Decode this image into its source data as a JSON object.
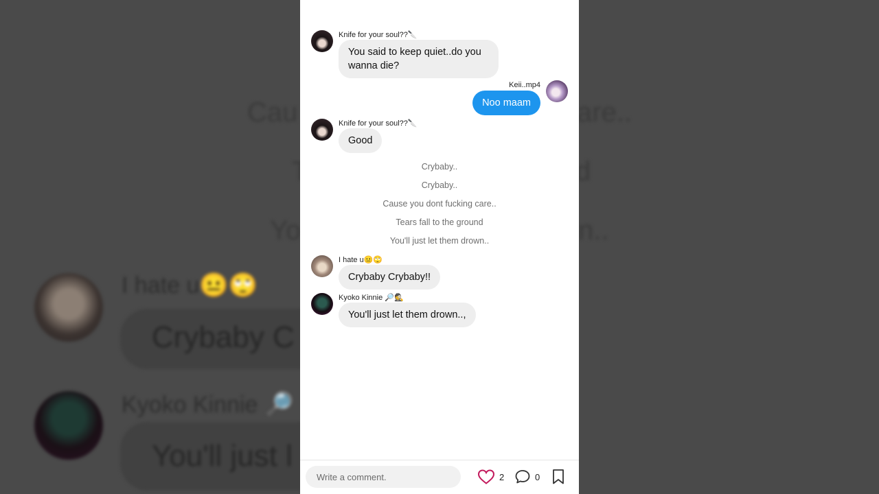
{
  "background": {
    "line1_left": "Cau",
    "line1_right": "are..",
    "line2_left": "T",
    "line2_right": "d",
    "line3_left": "Yo",
    "line3_right": "n..",
    "name1": "I hate u😐🙄",
    "msg1": "Crybaby C",
    "name2": "Kyoko Kinnie 🔎",
    "msg2": "You'll just l"
  },
  "messages": [
    {
      "sender": "Knife for your soul??🔪",
      "text_line1": "You said to keep quiet..do you",
      "text_line2": "wanna die?"
    },
    {
      "sender": "Keii..mp4",
      "text": "Noo maam"
    },
    {
      "sender": "Knife for your soul??🔪",
      "text": "Good"
    },
    {
      "sender": "I hate u😐🙄",
      "text": "Crybaby Crybaby!!"
    },
    {
      "sender": "Kyoko Kinnie 🔎🕵",
      "text": "You'll just let them drown..,"
    }
  ],
  "lyrics": [
    "Crybaby..",
    "Crybaby..",
    "Cause you dont fucking care..",
    "Tears fall to the ground",
    "You'll just let them drown.."
  ],
  "bottom_bar": {
    "comment_placeholder": "Write a comment.",
    "likes": "2",
    "comments": "0"
  },
  "colors": {
    "my_bubble": "#1d95ee",
    "other_bubble": "#eeeeee",
    "heart": "#c2185b"
  }
}
